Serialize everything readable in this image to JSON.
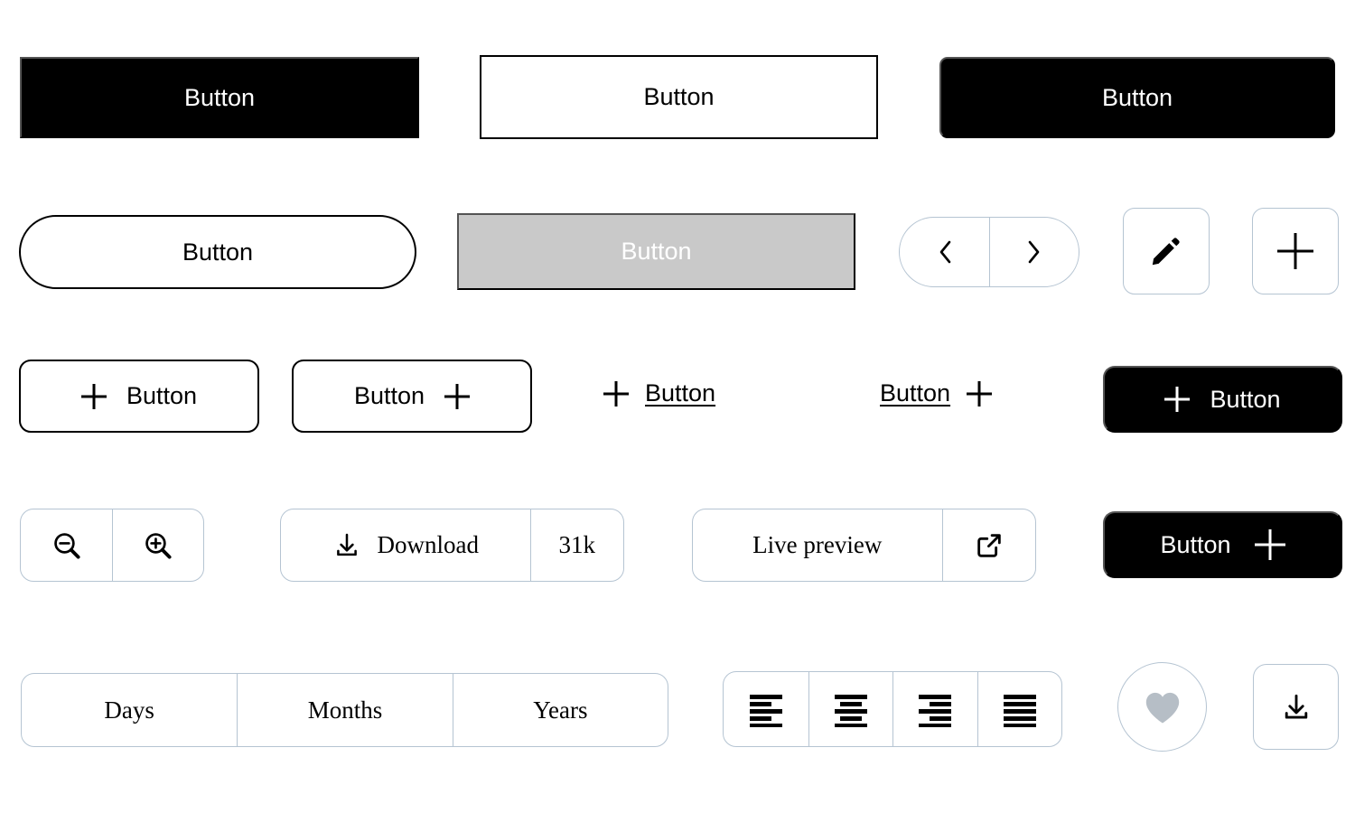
{
  "theme": {
    "bg": "#ffffff",
    "ink": "#000000",
    "solid_bg": "#000000",
    "solid_text": "#ffffff",
    "disabled_bg": "#c9c9c9",
    "disabled_text": "#ffffff",
    "border_black": "#000000",
    "border_light": "#b5c4d2",
    "heart_fill": "#b6bec6"
  },
  "row1": {
    "filled_square": {
      "label": "Button",
      "icon": null
    },
    "outlined_square": {
      "label": "Button",
      "icon": null
    },
    "filled_rounded": {
      "label": "Button",
      "icon": null
    }
  },
  "row2": {
    "outlined_pill": {
      "label": "Button"
    },
    "disabled": {
      "label": "Button"
    },
    "pagination": {
      "prev_icon": "chevron-left-icon",
      "next_icon": "chevron-right-icon"
    },
    "edit_button": {
      "icon": "pencil-icon"
    },
    "add_button": {
      "icon": "plus-icon"
    }
  },
  "row3": {
    "outline_plus_left": {
      "label": "Button",
      "icon": "plus-icon"
    },
    "outline_plus_right": {
      "label": "Button",
      "icon": "plus-icon"
    },
    "link_plus_left": {
      "label": "Button",
      "icon": "plus-icon"
    },
    "link_plus_right": {
      "label": "Button",
      "icon": "plus-icon"
    },
    "solid_plus_left": {
      "label": "Button",
      "icon": "plus-icon"
    }
  },
  "row4": {
    "zoom_group": {
      "zoom_out_icon": "zoom-out-icon",
      "zoom_in_icon": "zoom-in-icon"
    },
    "download_group": {
      "label": "Download",
      "icon": "download-icon",
      "count": "31k"
    },
    "live_preview_group": {
      "label": "Live preview",
      "icon": "external-link-icon"
    },
    "solid_plus_right": {
      "label": "Button",
      "icon": "plus-icon"
    }
  },
  "row5": {
    "period_segmented": {
      "options": [
        "Days",
        "Months",
        "Years"
      ],
      "selected": "Days"
    },
    "align_segmented": {
      "options": [
        "align-left-icon",
        "align-center-icon",
        "align-right-icon",
        "align-justify-icon"
      ]
    },
    "favorite_button": {
      "icon": "heart-icon"
    },
    "download_icon_button": {
      "icon": "download-icon"
    }
  }
}
